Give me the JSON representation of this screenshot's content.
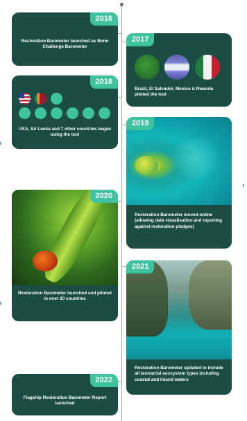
{
  "timeline": {
    "entries": [
      {
        "year": "2016",
        "caption": "Restoration Barometer launched as Bonn Challenge Barometer"
      },
      {
        "year": "2017",
        "caption": "Brazil, El Salvador, Mexico & Rwanda piloted the tool"
      },
      {
        "year": "2018",
        "caption": "USA, Sri Lanka and 7 other countries began using the tool"
      },
      {
        "year": "2019",
        "caption": "Restoration Barometer moved online (allowing data visualisation and reporting against restoration pledges)"
      },
      {
        "year": "2020",
        "caption": "Restoration Barometer launched and piloted in over 20 countries"
      },
      {
        "year": "2021",
        "caption": "Restoration Barometer updated to include all terrestrial ecosystem types including coastal and inland waters"
      },
      {
        "year": "2022",
        "caption": "Flagship Restoration Barometer Report launched"
      }
    ]
  },
  "colors": {
    "card": "#1b4d45",
    "accent": "#3ec3a0",
    "axis": "#9aa7a2"
  },
  "icons": {
    "flags_2017": [
      "brazil-flag-icon",
      "el-salvador-flag-icon",
      "mexico-flag-icon"
    ],
    "flags_2018": [
      "usa-flag-icon",
      "sri-lanka-flag-icon"
    ]
  }
}
